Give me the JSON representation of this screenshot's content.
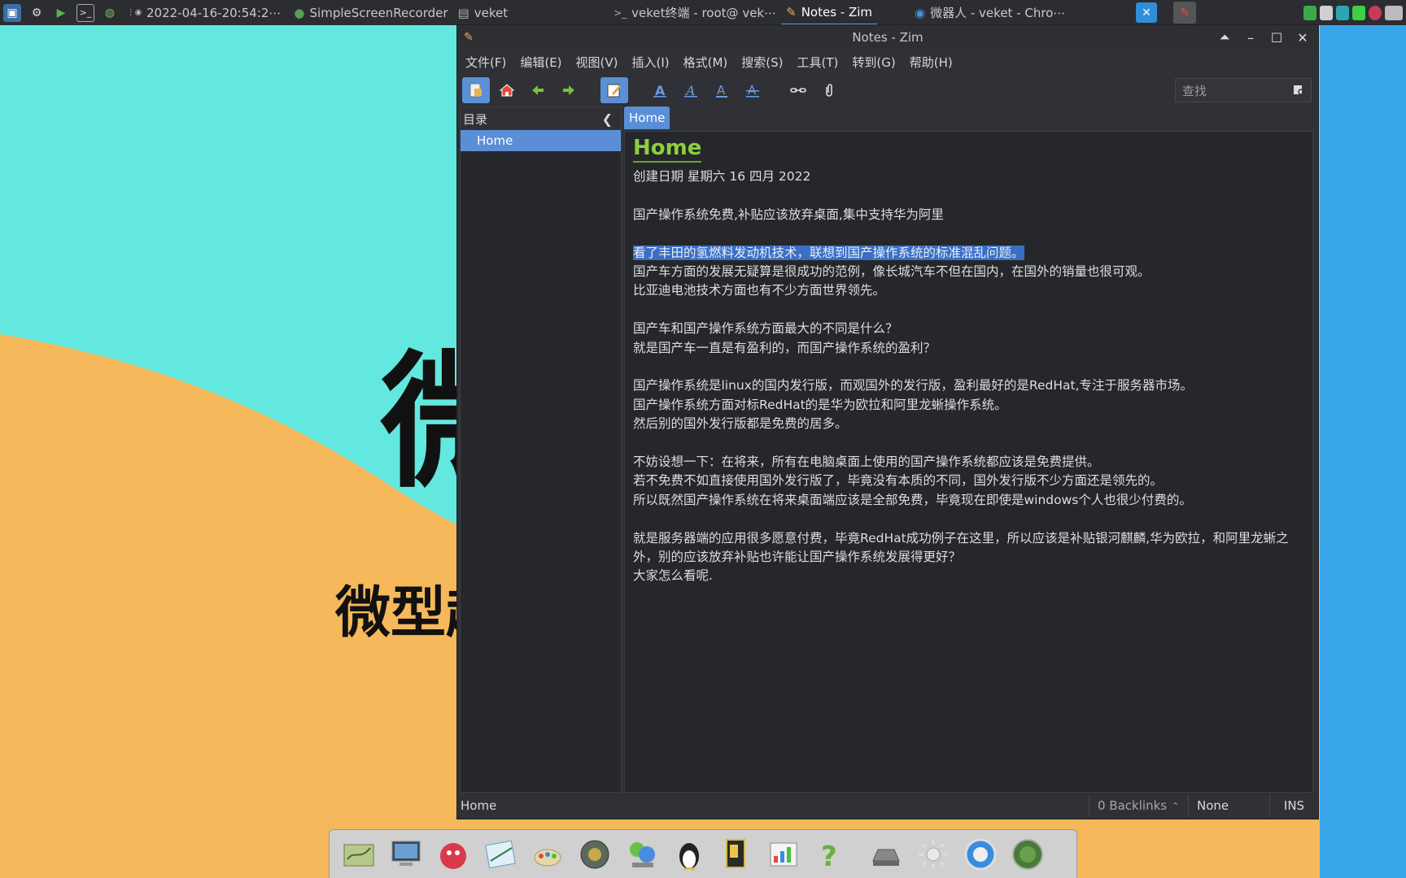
{
  "taskbar": {
    "clock": "2022-04-16-20:54:2⋯",
    "tasks": [
      {
        "label": "SimpleScreenRecorder",
        "icon": "recorder-icon",
        "active": false
      },
      {
        "label": "veket",
        "icon": "folder-icon",
        "active": false
      },
      {
        "label": "veket终端 - root@ vek⋯",
        "icon": "terminal-icon",
        "active": false
      },
      {
        "label": "Notes - Zim",
        "icon": "zim-icon",
        "active": true
      },
      {
        "label": "微器人 - veket - Chro⋯",
        "icon": "chrome-icon",
        "active": false
      }
    ]
  },
  "desktop": {
    "big_glyph": "微",
    "subtitle": "微型超"
  },
  "window": {
    "title": "Notes - Zim",
    "menu": [
      "文件(F)",
      "编辑(E)",
      "视图(V)",
      "插入(I)",
      "格式(M)",
      "搜索(S)",
      "工具(T)",
      "转到(G)",
      "帮助(H)"
    ],
    "search_placeholder": "查找",
    "sidebar": {
      "header": "目录",
      "items": [
        {
          "label": "Home",
          "selected": true
        }
      ]
    },
    "tab": "Home",
    "page": {
      "title": "Home",
      "created": "创建日期 星期六 16 四月 2022",
      "lines": [
        "",
        "国产操作系统免费,补贴应该放弃桌面,集中支持华为阿里",
        "",
        "看了丰田的氢燃料发动机技术，联想到国产操作系统的标准混乱问题。",
        "国产车方面的发展无疑算是很成功的范例，像长城汽车不但在国内，在国外的销量也很可观。",
        "比亚迪电池技术方面也有不少方面世界领先。",
        "",
        "国产车和国产操作系统方面最大的不同是什么？",
        "就是国产车一直是有盈利的，而国产操作系统的盈利？",
        "",
        "国产操作系统是linux的国内发行版，而观国外的发行版，盈利最好的是RedHat,专注于服务器市场。",
        "国产操作系统方面对标RedHat的是华为欧拉和阿里龙蜥操作系统。",
        "然后别的国外发行版都是免费的居多。",
        "",
        "不妨设想一下：在将来，所有在电脑桌面上使用的国产操作系统都应该是免费提供。",
        "若不免费不如直接使用国外发行版了，毕竟没有本质的不同，国外发行版不少方面还是领先的。",
        "所以既然国产操作系统在将来桌面端应该是全部免费，毕竟现在即使是windows个人也很少付费的。",
        "",
        "就是服务器端的应用很多愿意付费，毕竟RedHat成功例子在这里，所以应该是补贴银河麒麟,华为欧拉，和阿里龙蜥之外，别的应该放弃补贴也许能让国产操作系统发展得更好？",
        "大家怎么看呢."
      ],
      "selected_line_index": 3
    },
    "status": {
      "page": "Home",
      "backlinks": "0 Backlinks",
      "style": "None",
      "mode": "INS"
    }
  },
  "colors": {
    "accent": "#5a8fd8",
    "title_green": "#8dce3e",
    "bg_cyan": "#62e8df",
    "bg_orange": "#f5b85b",
    "bg_blue": "#3aa6ea"
  }
}
